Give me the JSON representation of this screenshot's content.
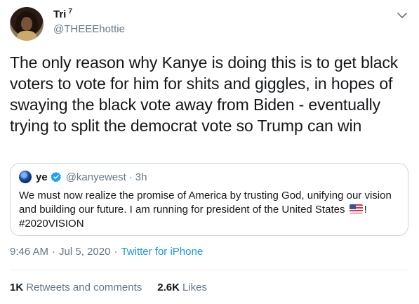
{
  "author": {
    "display_name": "Tri",
    "superscript": "7",
    "handle": "@THEEEhottie"
  },
  "tweet": {
    "text": "The only reason why Kanye is doing this is to get black voters to vote for him for shits and giggles, in hopes of swaying the black vote away from Biden - eventually trying to split the democrat vote so Trump can win"
  },
  "quote": {
    "name": "ye",
    "handle": "@kanyewest",
    "separator": "·",
    "time": "3h",
    "text_before_flag": "We must now realize the promise of America by trusting God, unifying our vision and building our future. I am running for president of the United States ",
    "text_after_flag": "! #2020VISION"
  },
  "meta": {
    "time": "9:46 AM",
    "separator1": "·",
    "date": "Jul 5, 2020",
    "separator2": "·",
    "source": "Twitter for iPhone"
  },
  "stats": {
    "retweets_count": "1K",
    "retweets_label": "Retweets and comments",
    "likes_count": "2.6K",
    "likes_label": "Likes"
  },
  "icons": {
    "caret": "chevron-down-icon",
    "verified": "verified-badge-icon",
    "flag": "us-flag-emoji"
  },
  "colors": {
    "text": "#14171a",
    "secondary": "#657786",
    "link": "#1b95e0",
    "verified": "#1da1f2",
    "border": "#ccd6dd"
  }
}
